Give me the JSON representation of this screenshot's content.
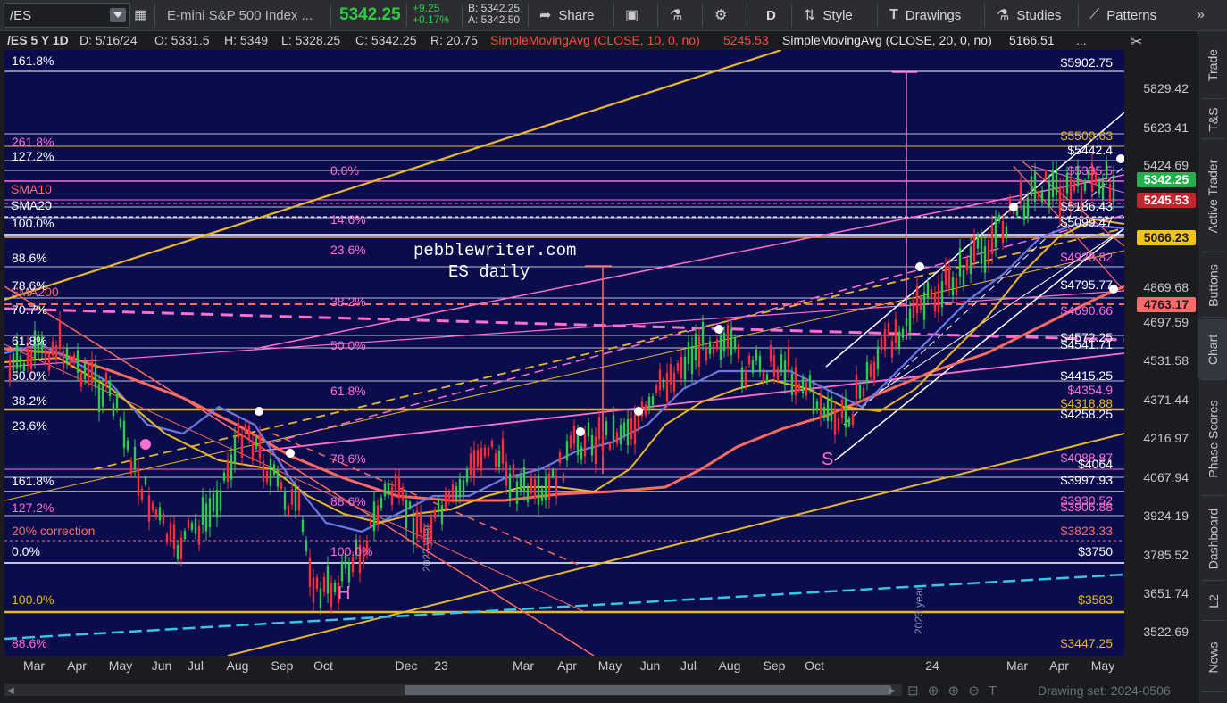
{
  "toolbar": {
    "symbol": "/ES",
    "description": "E-mini S&P 500 Index ...",
    "last": "5342.25",
    "change": "+9.25",
    "change_pct": "+0.17%",
    "bid": "B: 5342.25",
    "ask": "A: 5342.50",
    "share_label": "Share",
    "period_label": "D",
    "style_label": "Style",
    "drawings_label": "Drawings",
    "studies_label": "Studies",
    "patterns_label": "Patterns"
  },
  "infobar": {
    "symbol_period": "/ES 5 Y 1D",
    "date": "D: 5/16/24",
    "open": "O: 5331.5",
    "high": "H: 5349",
    "low": "L: 5328.25",
    "close": "C: 5342.25",
    "range": "R: 20.75",
    "sma10_label": "SimpleMovingAvg (CLOSE, 10, 0, no)",
    "sma10_value": "5245.53",
    "sma20_label": "SimpleMovingAvg (CLOSE, 20, 0, no)",
    "sma20_value": "5166.51",
    "more": "..."
  },
  "chart_labels": {
    "watermark_site": "pebblewriter.com",
    "watermark_title": "ES daily",
    "h_mark": "H",
    "s_mark": "S",
    "year_2023": "2023 year",
    "sma10": "SMA10",
    "sma20": "SMA20",
    "sma200": "SMA200"
  },
  "left_fibs": [
    "161.8%",
    "261.8%",
    "127.2%",
    "100.0%",
    "88.6%",
    "78.6%",
    "70.7%",
    "61.8%",
    "50.0%",
    "38.2%",
    "23.6%",
    "161.8%",
    "127.2%",
    "20% correction",
    "0.0%",
    "100.0%",
    "88.6%"
  ],
  "mid_fibs": [
    "0.0%",
    "14.6%",
    "23.6%",
    "38.2%",
    "50.0%",
    "61.8%",
    "78.6%",
    "88.6%",
    "100.0%"
  ],
  "price_labels": [
    "$5902.75",
    "$5509.63",
    "$5442.4",
    "$5335.5",
    "$5186.43",
    "$5099.47",
    "$4928.82",
    "$4795.77",
    "$4690.66",
    "$4572.25",
    "$4541.71",
    "$4415.25",
    "$4354.9",
    "$4318.88",
    "$4258.25",
    "$4088.87",
    "$4064",
    "$3997.93",
    "$3930.52",
    "$3906.88",
    "$3823.33",
    "$3750",
    "$3583",
    "$3447.25"
  ],
  "y_ticks": [
    "5829.42",
    "5623.41",
    "5424.69",
    "4869.68",
    "4697.59",
    "4531.58",
    "4371.44",
    "4216.97",
    "4067.94",
    "3924.19",
    "3785.52",
    "3651.74",
    "3522.69"
  ],
  "price_tags": {
    "last": "5342.25",
    "sma10": "5245.53",
    "sma20": "5066.23",
    "sma200": "4763.17"
  },
  "x_ticks": [
    "Mar",
    "Apr",
    "May",
    "Jun",
    "Jul",
    "Aug",
    "Sep",
    "Oct",
    "Dec",
    "23",
    "Mar",
    "Apr",
    "May",
    "Jun",
    "Jul",
    "Aug",
    "Sep",
    "Oct",
    "24",
    "Mar",
    "Apr",
    "May"
  ],
  "right_tabs": [
    "Trade",
    "T&S",
    "Active Trader",
    "Buttons",
    "Chart",
    "Phase Scores",
    "Dashboard",
    "L2",
    "News"
  ],
  "drawing_set": "Drawing set: 2024-0506",
  "colors": {
    "chart_bg": "#0a0c4c",
    "gold": "#e8b827",
    "pink": "#ff6fd0",
    "salmon": "#ff6a5e",
    "blue": "#6b78e0",
    "green_up": "#2ecc40",
    "red_down": "#ff2d2d",
    "cyan": "#35c6e8",
    "last_tag": "#22b14c",
    "sma10_tag": "#c0262c",
    "sma20_tag": "#f0c419",
    "sma200_tag": "#ff6a6a"
  }
}
